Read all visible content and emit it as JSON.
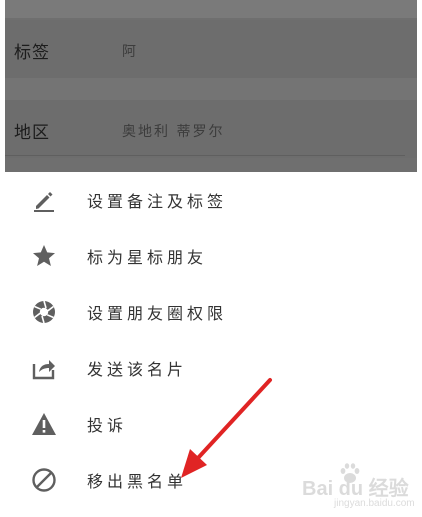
{
  "profile": {
    "rows": [
      {
        "label": "标签",
        "value": "阿"
      },
      {
        "label": "地区",
        "value": "奥地利  蒂罗尔"
      }
    ]
  },
  "menu": {
    "items": [
      {
        "label": "设置备注及标签",
        "icon": "pencil-icon"
      },
      {
        "label": "标为星标朋友",
        "icon": "star-icon"
      },
      {
        "label": "设置朋友圈权限",
        "icon": "aperture-icon"
      },
      {
        "label": "发送该名片",
        "icon": "share-icon"
      },
      {
        "label": "投诉",
        "icon": "warning-icon"
      },
      {
        "label": "移出黑名单",
        "icon": "block-icon"
      }
    ]
  },
  "watermark": {
    "text": "Bai du 经验",
    "sub": "jingyan.baidu.com"
  },
  "colors": {
    "overlay": "#6f6f6f",
    "icon": "#5f5f5f",
    "text": "#333333",
    "annotation_arrow": "#e02424"
  }
}
